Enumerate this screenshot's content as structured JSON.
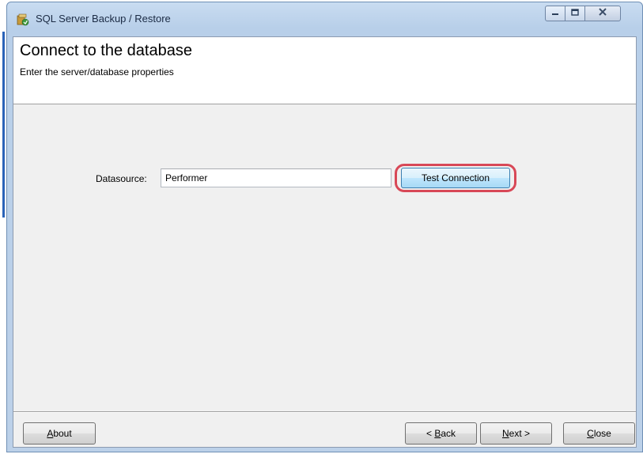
{
  "window": {
    "title": "SQL Server Backup / Restore"
  },
  "header": {
    "title": "Connect to the database",
    "subtitle": "Enter the server/database properties"
  },
  "form": {
    "datasource_label": "Datasource:",
    "datasource_value": "Performer",
    "test_connection_label": "Test Connection"
  },
  "footer": {
    "about": {
      "mnemonic": "A",
      "rest": "bout"
    },
    "back": {
      "prefix": "< ",
      "mnemonic": "B",
      "rest": "ack"
    },
    "next": {
      "mnemonic": "N",
      "rest": "ext >"
    },
    "close": {
      "mnemonic": "C",
      "rest": "lose"
    }
  },
  "colors": {
    "highlight_ring": "#d32a3c",
    "window_frame": "#b8cfe9",
    "client_background": "#f0f0f0"
  },
  "icons": {
    "app": "database-app-icon",
    "minimize": "minimize-icon",
    "maximize": "maximize-icon",
    "close": "close-icon"
  }
}
